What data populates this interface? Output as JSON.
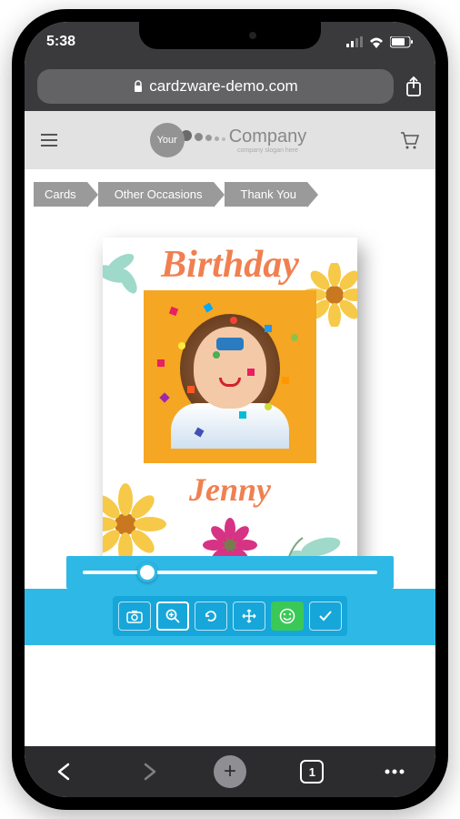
{
  "status": {
    "time": "5:38"
  },
  "browser": {
    "url": "cardzware-demo.com",
    "tab_count": "1"
  },
  "site": {
    "logo_primary": "Your",
    "logo_secondary": "Company",
    "logo_slogan": "company slogan here"
  },
  "breadcrumbs": [
    "Cards",
    "Other Occasions",
    "Thank You"
  ],
  "card": {
    "title": "Birthday",
    "name": "Jenny"
  },
  "editor": {
    "slider_value": 22,
    "tools": [
      "camera",
      "zoom",
      "rotate",
      "move",
      "emoji",
      "confirm"
    ],
    "active_tool": "zoom"
  },
  "colors": {
    "editor_bar": "#2eb8e6",
    "accent": "#f08050",
    "green": "#3ac957"
  }
}
